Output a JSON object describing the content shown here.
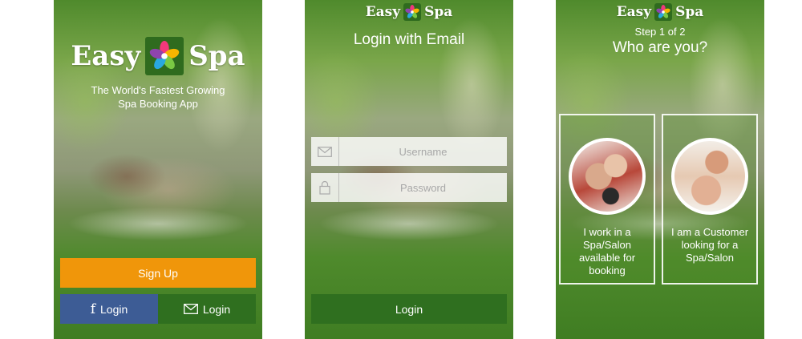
{
  "brand": {
    "word1": "Easy",
    "word2": "Spa"
  },
  "screen1": {
    "tagline_line1": "The World's Fastest Growing",
    "tagline_line2": "Spa Booking App",
    "signup_label": "Sign Up",
    "facebook_login_label": "Login",
    "email_login_label": "Login"
  },
  "screen2": {
    "title": "Login with Email",
    "username_placeholder": "Username",
    "password_placeholder": "Password",
    "login_label": "Login"
  },
  "screen3": {
    "step": "Step 1 of 2",
    "title": "Who are you?",
    "option1_text": "I work in a Spa/Salon available for booking",
    "option2_text": "I am a Customer looking for a Spa/Salon"
  },
  "colors": {
    "signup": "#f0960a",
    "facebook": "#3d5c95",
    "email_login": "#2f6f1f",
    "login_button": "#2f6f1f"
  }
}
